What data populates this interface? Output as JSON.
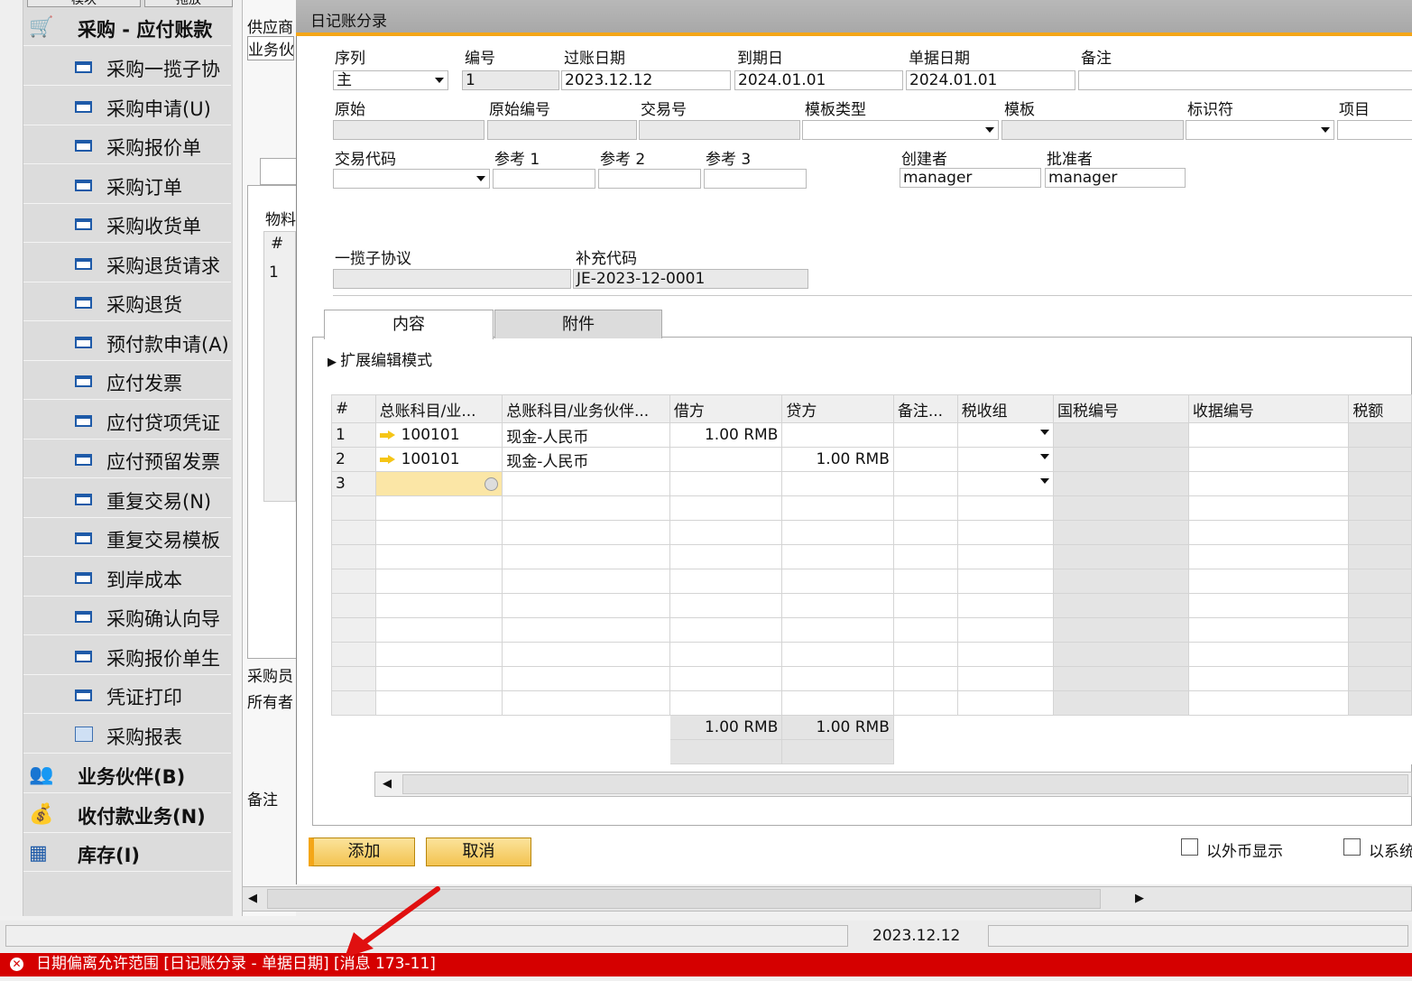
{
  "sidebar": {
    "section_title": "采购 - 应付账款",
    "items": [
      {
        "label": "采购一揽子协"
      },
      {
        "label": "采购申请(U)"
      },
      {
        "label": "采购报价单"
      },
      {
        "label": "采购订单"
      },
      {
        "label": "采购收货单"
      },
      {
        "label": "采购退货请求"
      },
      {
        "label": "采购退货"
      },
      {
        "label": "预付款申请(A)"
      },
      {
        "label": "应付发票"
      },
      {
        "label": "应付贷项凭证"
      },
      {
        "label": "应付预留发票"
      },
      {
        "label": "重复交易(N)"
      },
      {
        "label": "重复交易模板"
      },
      {
        "label": "到岸成本"
      },
      {
        "label": "采购确认向导"
      },
      {
        "label": "采购报价单生"
      },
      {
        "label": "凭证打印"
      },
      {
        "label": "采购报表"
      }
    ],
    "modules": [
      {
        "label": "业务伙伴(B)"
      },
      {
        "label": "收付款业务(N)"
      },
      {
        "label": "库存(I)"
      }
    ]
  },
  "bg_form": {
    "top_labels": [
      "模块",
      "拖放"
    ],
    "lbl_vendor": "供应商",
    "lbl_partner": "业务伙",
    "lbl_item": "物料",
    "lbl_hash": "#",
    "row1": "1",
    "lbl_buyer": "采购员",
    "lbl_owner": "所有者",
    "lbl_remark": "备注"
  },
  "dialog": {
    "title": "日记账分录",
    "header": {
      "series_label": "序列",
      "series_value": "主",
      "number_label": "编号",
      "number_value": "1",
      "posting_date_label": "过账日期",
      "posting_date_value": "2023.12.12",
      "due_date_label": "到期日",
      "due_date_value": "2024.01.01",
      "doc_date_label": "单据日期",
      "doc_date_value": "2024.01.01",
      "remarks_label": "备注",
      "origin_label": "原始",
      "origin_no_label": "原始编号",
      "trans_no_label": "交易号",
      "template_type_label": "模板类型",
      "template_label": "模板",
      "indicator_label": "标识符",
      "project_label": "项目",
      "trans_code_label": "交易代码",
      "ref1_label": "参考 1",
      "ref2_label": "参考 2",
      "ref3_label": "参考 3",
      "creator_label": "创建者",
      "creator_value": "manager",
      "approver_label": "批准者",
      "approver_value": "manager",
      "blanket_label": "一揽子协议",
      "supp_code_label": "补充代码",
      "supp_code_value": "JE-2023-12-0001"
    },
    "tabs": [
      {
        "label": "内容"
      },
      {
        "label": "附件"
      }
    ],
    "expand_mode": "扩展编辑模式",
    "grid": {
      "columns": [
        "#",
        "总账科目/业...",
        "总账科目/业务伙伴...",
        "借方",
        "贷方",
        "备注...",
        "税收组",
        "国税编号",
        "收据编号",
        "税额"
      ],
      "rows": [
        {
          "no": "1",
          "account": "100101",
          "name": "现金-人民币",
          "debit": "1.00 RMB",
          "credit": ""
        },
        {
          "no": "2",
          "account": "100101",
          "name": "现金-人民币",
          "debit": "",
          "credit": "1.00 RMB"
        },
        {
          "no": "3",
          "account": "",
          "name": "",
          "debit": "",
          "credit": ""
        }
      ],
      "total_debit": "1.00 RMB",
      "total_credit": "1.00 RMB"
    },
    "add_button": "添加",
    "cancel_button": "取消",
    "chk_fc": "以外币显示",
    "chk_sc": "以系统"
  },
  "statusbar": {
    "date": "2023.12.12"
  },
  "error": {
    "message": "日期偏离允许范围 [日记账分录 - 单据日期] [消息 173-11]"
  },
  "colors": {
    "accent": "#f4a617",
    "error": "#d50000",
    "annotation_arrow": "#e01010"
  }
}
